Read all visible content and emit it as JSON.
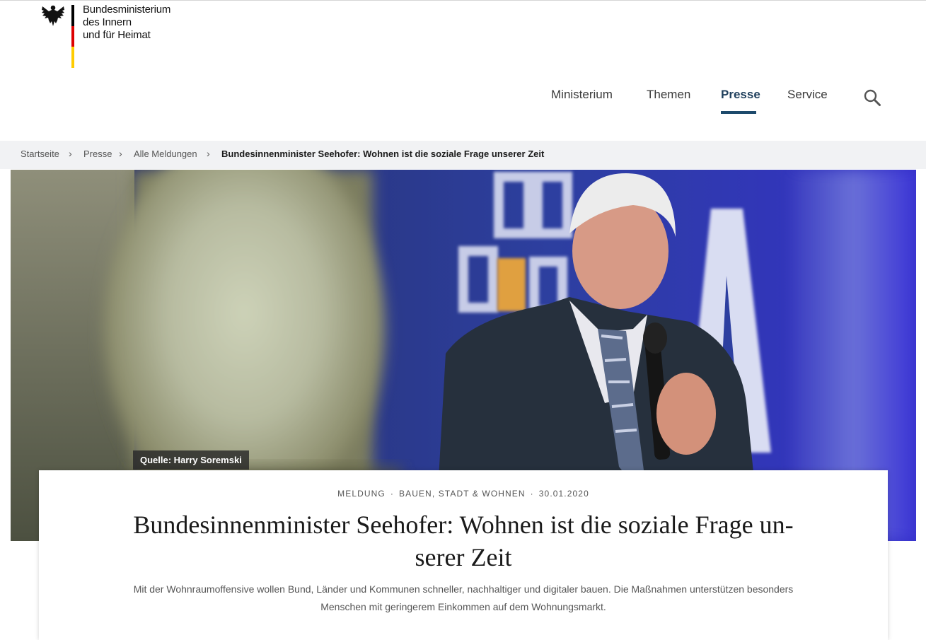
{
  "logo": {
    "line1": "Bundesministerium",
    "line2": "des Innern",
    "line3": "und für Heimat",
    "icon": "federal-eagle"
  },
  "nav": {
    "items": [
      "Ministerium",
      "Themen",
      "Presse",
      "Service"
    ],
    "active": "Presse",
    "search_icon": "search-icon"
  },
  "breadcrumb": {
    "items": [
      "Startseite",
      "Presse",
      "Alle Meldungen"
    ],
    "current": "Bundesinnenminister Seehofer: Wohnen ist die soziale Frage unserer Zeit"
  },
  "hero": {
    "credit": "Quelle: Harry Soremski"
  },
  "article": {
    "type": "MELDUNG",
    "category": "BAUEN, STADT & WOHNEN",
    "date": "30.01.2020",
    "title_line1": "Bundesinnenminister Seehofer: Wohnen ist die soziale Frage un-",
    "title_line2": "serer Zeit",
    "lead_line1": "Mit der Wohnraumoffensive wollen Bund, Länder und Kommunen schneller, nachhaltiger und digitaler bauen. Die Maßnahmen unterstützen besonders",
    "lead_line2": "Menschen mit geringerem Einkommen auf dem Wohnungsmarkt."
  },
  "colors": {
    "accent": "#1d4a6c",
    "breadcrumb_bg": "#f1f2f4",
    "flag_black": "#000000",
    "flag_red": "#dd0000",
    "flag_gold": "#ffcc00"
  }
}
